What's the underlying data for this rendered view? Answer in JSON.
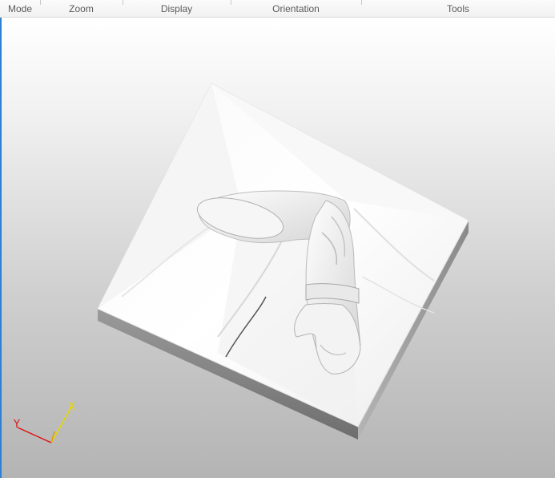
{
  "ribbon": {
    "groups": [
      {
        "label": "Mode"
      },
      {
        "label": "Zoom"
      },
      {
        "label": "Display"
      },
      {
        "label": "Orientation"
      },
      {
        "label": "Tools"
      }
    ]
  },
  "viewport": {
    "axes": {
      "x_label": "X",
      "y_label": "Y",
      "x_color": "#e6d800",
      "y_color": "#e01010"
    }
  },
  "colors": {
    "viewport_accent": "#2f7fd4",
    "model": "#f2f2f2"
  }
}
